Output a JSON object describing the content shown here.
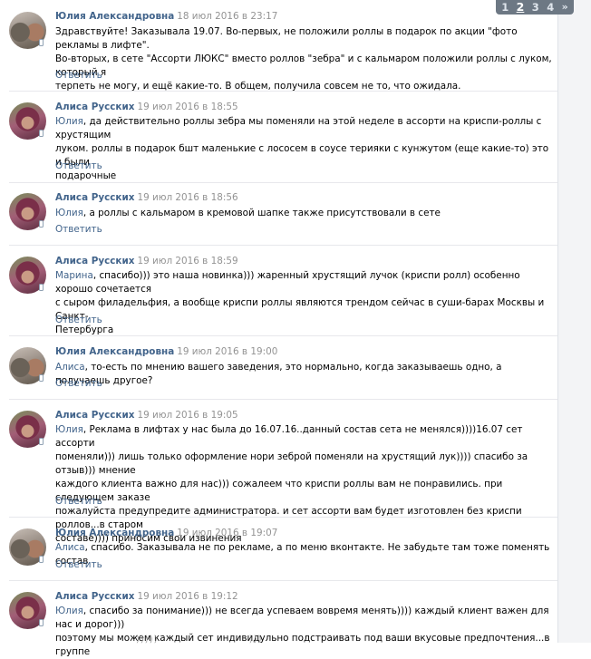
{
  "pagination": {
    "pages": [
      "1",
      "2",
      "3",
      "4"
    ],
    "current": "2",
    "next": "»"
  },
  "reply_label": "Ответить",
  "comments": [
    {
      "author": "Юлия Александровна",
      "date": "18 июл 2016 в 23:17",
      "avatar": "yulia",
      "mention": "",
      "lines": [
        "Здравствуйте! Заказывала 19.07. Во-первых, не положили роллы в подарок по акции \"фото рекламы в лифте\".",
        "Во-вторых, в сете \"Ассорти ЛЮКС\" вместо роллов \"зебра\" и с кальмаром положили роллы с луком, который я",
        "терпеть не могу, и ещё какие-то. В общем, получила совсем не то, что ожидала."
      ]
    },
    {
      "author": "Алиса Русских",
      "date": "19 июл 2016 в 18:55",
      "avatar": "alisa",
      "mention": "Юлия",
      "lines": [
        ", да действительно роллы зебра мы поменяли на этой неделе в ассорти на криспи-роллы с хрустящим",
        "луком. роллы в подарок бшт маленькие с лососем в соусе терияки с кунжутом (еще какие-то) это и были",
        "подарочные"
      ]
    },
    {
      "author": "Алиса Русских",
      "date": "19 июл 2016 в 18:56",
      "avatar": "alisa",
      "mention": "Юлия",
      "lines": [
        ", а роллы с кальмаром в кремовой шапке также присутствовали в сете"
      ]
    },
    {
      "author": "Алиса Русских",
      "date": "19 июл 2016 в 18:59",
      "avatar": "alisa",
      "mention": "Марина",
      "lines": [
        ", спасибо))) это наша новинка))) жаренный хрустящий лучок (криспи ролл) особенно хорошо сочетается",
        "с сыром филадельфия, а вообще криспи роллы являются трендом сейчас в суши-барах Москвы и Санкт-",
        "Петербурга"
      ]
    },
    {
      "author": "Юлия Александровна",
      "date": "19 июл 2016 в 19:00",
      "avatar": "yulia",
      "mention": "Алиса",
      "lines": [
        ", то-есть по мнению вашего заведения, это нормально, когда заказываешь одно, а получаешь другое?"
      ]
    },
    {
      "author": "Алиса Русских",
      "date": "19 июл 2016 в 19:05",
      "avatar": "alisa",
      "mention": "Юлия",
      "lines": [
        ", Реклама в лифтах у нас была до 16.07.16..данный состав сета не менялся))))16.07 сет ассорти",
        "поменяли))) лишь только оформление нори зеброй поменяли на хрустящий лук)))) спасибо за отзыв))) мнение",
        "каждого клиента важно для нас))) сожалеем что криспи роллы вам не понравились. при следующем заказе",
        "пожалуйста предупредите администратора. и сет ассорти вам будет изготовлен без криспи роллов...в старом",
        "составе)))) приносим свои извинения"
      ]
    },
    {
      "author": "Юлия Александровна",
      "date": "19 июл 2016 в 19:07",
      "avatar": "yulia",
      "mention": "Алиса",
      "lines": [
        ", спасибо. Заказывала не по рекламе, а по меню вконтакте. Не забудьте там тоже поменять состав"
      ]
    },
    {
      "author": "Алиса Русских",
      "date": "19 июл 2016 в 19:12",
      "avatar": "alisa",
      "mention": "Юлия",
      "lines": [
        ", спасибо за понимание))) не всегда успеваем вовремя менять)))) каждый клиент важен для нас и дорог)))",
        "поэтому мы можем каждый сет индивидульно подстраивать под ваши вкусовые предпочтения...в группе"
      ]
    }
  ]
}
